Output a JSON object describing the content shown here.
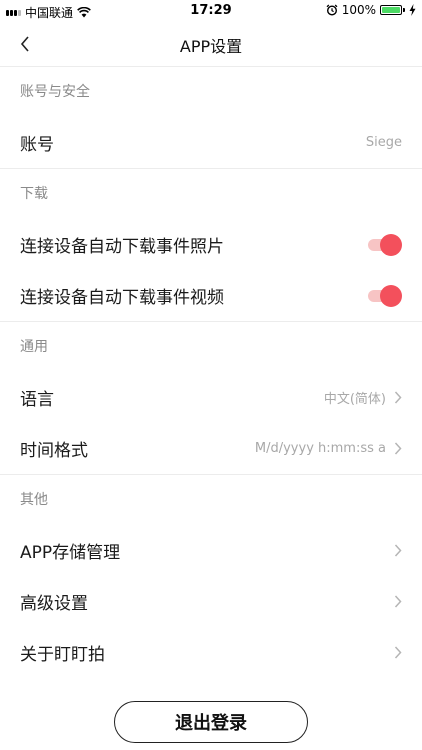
{
  "status_bar": {
    "carrier": "中国联通",
    "time": "17:29",
    "battery": "100%"
  },
  "nav": {
    "title": "APP设置"
  },
  "sections": {
    "account": {
      "header": "账号与安全",
      "account_label": "账号",
      "account_value": "Siege"
    },
    "download": {
      "header": "下载",
      "photos_label": "连接设备自动下载事件照片",
      "photos_on": true,
      "videos_label": "连接设备自动下载事件视频",
      "videos_on": true
    },
    "general": {
      "header": "通用",
      "language_label": "语言",
      "language_value": "中文(简体)",
      "time_format_label": "时间格式",
      "time_format_value": "M/d/yyyy h:mm:ss a"
    },
    "other": {
      "header": "其他",
      "storage_label": "APP存储管理",
      "advanced_label": "高级设置",
      "about_label": "关于盯盯拍"
    }
  },
  "logout_label": "退出登录",
  "colors": {
    "accent": "#f3505c",
    "toggle_track": "#f7c4c4",
    "battery": "#4cd964"
  }
}
